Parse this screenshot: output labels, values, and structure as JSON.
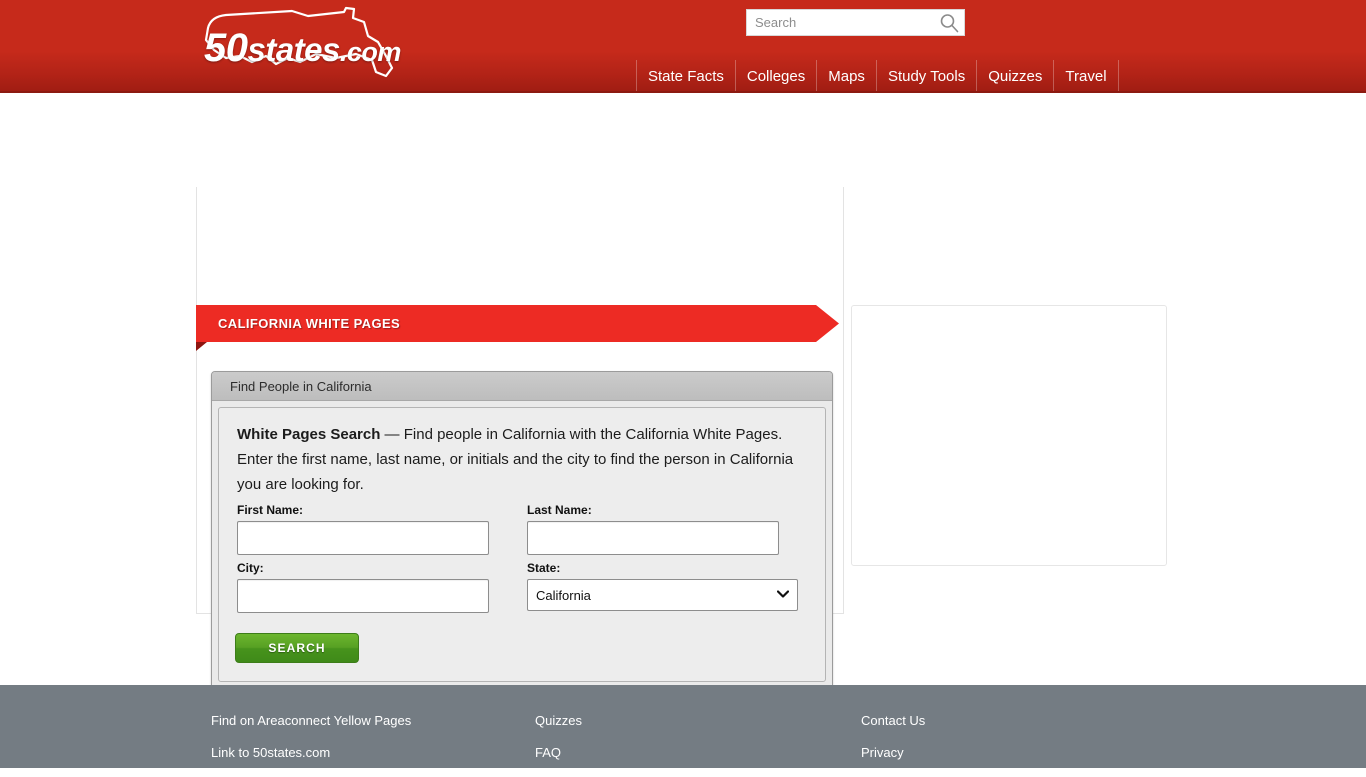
{
  "header": {
    "logo": {
      "number": "50",
      "word": "states",
      "domain": ".com",
      "icon": "usa-map-outline"
    },
    "search": {
      "placeholder": "Search",
      "value": "",
      "icon": "search-icon"
    },
    "nav": [
      {
        "label": "State Facts"
      },
      {
        "label": "Colleges"
      },
      {
        "label": "Maps"
      },
      {
        "label": "Study Tools"
      },
      {
        "label": "Quizzes"
      },
      {
        "label": "Travel"
      }
    ]
  },
  "main": {
    "ribbon_title": "CALIFORNIA WHITE PAGES",
    "widget": {
      "head_title": "Find People in California",
      "description_lead": "White Pages Search",
      "description_rest": " — Find people in California with the California White Pages. Enter the first name, last name, or initials and the city to find the person in California you are looking for.",
      "fields": {
        "first_name": {
          "label": "First Name:",
          "value": "",
          "placeholder": ""
        },
        "last_name": {
          "label": "Last Name:",
          "value": "",
          "placeholder": ""
        },
        "city": {
          "label": "City:",
          "value": "",
          "placeholder": ""
        },
        "state": {
          "label": "State:",
          "selected": "California",
          "chevron_icon": "chevron-down-icon"
        }
      },
      "submit_label": "SEARCH"
    }
  },
  "footer": {
    "columns": [
      {
        "links": [
          {
            "label": "Find on Areaconnect Yellow Pages"
          },
          {
            "label": "Link to 50states.com"
          }
        ]
      },
      {
        "links": [
          {
            "label": "Quizzes"
          },
          {
            "label": "FAQ"
          }
        ]
      },
      {
        "links": [
          {
            "label": "Contact Us"
          },
          {
            "label": "Privacy"
          }
        ]
      }
    ]
  },
  "colors": {
    "header_red": "#c62a1b",
    "ribbon_red": "#ed2b24",
    "ribbon_fold": "#8e1510",
    "button_green": "#57a023",
    "footer_gray": "#747c83"
  }
}
